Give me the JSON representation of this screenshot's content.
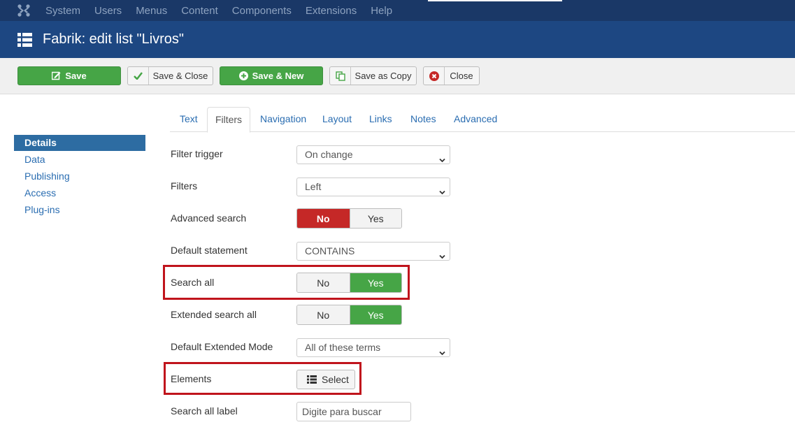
{
  "topbar": {
    "logo_icon": "joomla-logo-icon",
    "menu": [
      "System",
      "Users",
      "Menus",
      "Content",
      "Components",
      "Extensions",
      "Help"
    ]
  },
  "header": {
    "icon": "list-icon",
    "title": "Fabrik: edit list \"Livros\""
  },
  "toolbar": {
    "save": "Save",
    "save_close": "Save & Close",
    "save_new": "Save & New",
    "save_copy": "Save as Copy",
    "close": "Close"
  },
  "sidebar": {
    "items": [
      {
        "label": "Details",
        "active": true
      },
      {
        "label": "Data"
      },
      {
        "label": "Publishing"
      },
      {
        "label": "Access"
      },
      {
        "label": "Plug-ins"
      }
    ]
  },
  "tabs": [
    "Text",
    "Filters",
    "Navigation",
    "Layout",
    "Links",
    "Notes",
    "Advanced"
  ],
  "active_tab": "Filters",
  "form": {
    "filter_trigger": {
      "label": "Filter trigger",
      "value": "On change"
    },
    "filters": {
      "label": "Filters",
      "value": "Left"
    },
    "advanced_search": {
      "label": "Advanced search",
      "no": "No",
      "yes": "Yes",
      "selected": "No"
    },
    "default_statement": {
      "label": "Default statement",
      "value": "CONTAINS"
    },
    "search_all": {
      "label": "Search all",
      "no": "No",
      "yes": "Yes",
      "selected": "Yes"
    },
    "extended_search_all": {
      "label": "Extended search all",
      "no": "No",
      "yes": "Yes",
      "selected": "Yes"
    },
    "default_extended_mode": {
      "label": "Default Extended Mode",
      "value": "All of these terms"
    },
    "elements": {
      "label": "Elements",
      "button": "Select"
    },
    "search_all_label": {
      "label": "Search all label",
      "value": "Digite para buscar"
    }
  },
  "colors": {
    "topbar": "#1a3867",
    "header": "#1d4782",
    "success": "#46a546",
    "danger": "#c52827",
    "highlight": "#c0141c",
    "link": "#2a6db1"
  }
}
